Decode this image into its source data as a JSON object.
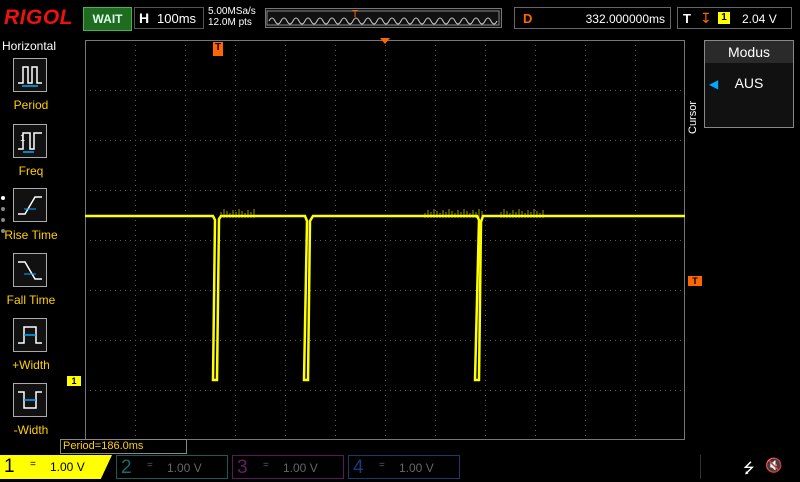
{
  "header": {
    "logo": "RIGOL",
    "run_status": "WAIT",
    "horizontal_letter": "H",
    "timebase": "100ms",
    "sample_rate": "5.00MSa/s",
    "mem_depth": "12.0M pts",
    "delay_letter": "D",
    "delay": "332.000000ms",
    "trigger_letter": "T",
    "trigger_source": "1",
    "trigger_level": "2.04 V"
  },
  "left_menu": {
    "title": "Horizontal",
    "items": [
      {
        "label": "Period",
        "icon": "period-icon"
      },
      {
        "label": "Freq",
        "icon": "freq-icon"
      },
      {
        "label": "Rise Time",
        "icon": "rise-time-icon"
      },
      {
        "label": "Fall Time",
        "icon": "fall-time-icon"
      },
      {
        "label": "+Width",
        "icon": "pos-width-icon"
      },
      {
        "label": "-Width",
        "icon": "neg-width-icon"
      }
    ]
  },
  "right_menu": {
    "side_label": "Cursor",
    "title": "Modus",
    "value": "AUS"
  },
  "measurement": "Period=186.0ms",
  "channels": [
    {
      "num": "1",
      "coupling": "=",
      "scale": "1.00 V",
      "color": "#ffff00",
      "active": true
    },
    {
      "num": "2",
      "coupling": "=",
      "scale": "1.00 V",
      "color": "#00c0c0",
      "active": false
    },
    {
      "num": "3",
      "coupling": "=",
      "scale": "1.00 V",
      "color": "#ff00ff",
      "active": false
    },
    {
      "num": "4",
      "coupling": "=",
      "scale": "1.00 V",
      "color": "#3090ff",
      "active": false
    }
  ],
  "markers": {
    "trigger_pos": "T",
    "ch1_ground": "1",
    "trigger_level_marker": "T"
  },
  "colors": {
    "trace": "#ffff00",
    "accent": "#ff6600",
    "grid": "#5a5a5a"
  }
}
